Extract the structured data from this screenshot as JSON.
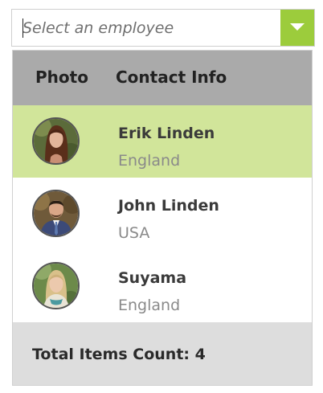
{
  "combobox": {
    "placeholder": "Select an employee",
    "value": "",
    "dropdown_icon": "triangle-down-icon",
    "accent_color": "#9ccc3c"
  },
  "popup": {
    "header": {
      "photo_label": "Photo",
      "contact_label": "Contact Info"
    },
    "items": [
      {
        "name": "Erik Linden",
        "country": "England",
        "selected": true,
        "avatar": "photo-of-woman-icon"
      },
      {
        "name": "John Linden",
        "country": "USA",
        "selected": false,
        "avatar": "photo-of-man-icon"
      },
      {
        "name": "Suyama",
        "country": "England",
        "selected": false,
        "avatar": "photo-of-woman-icon"
      }
    ],
    "footer": {
      "total_label": "Total Items Count: 4"
    },
    "selected_color": "#d1e59a",
    "header_color": "#aaaaaa",
    "footer_color": "#dddddd"
  }
}
